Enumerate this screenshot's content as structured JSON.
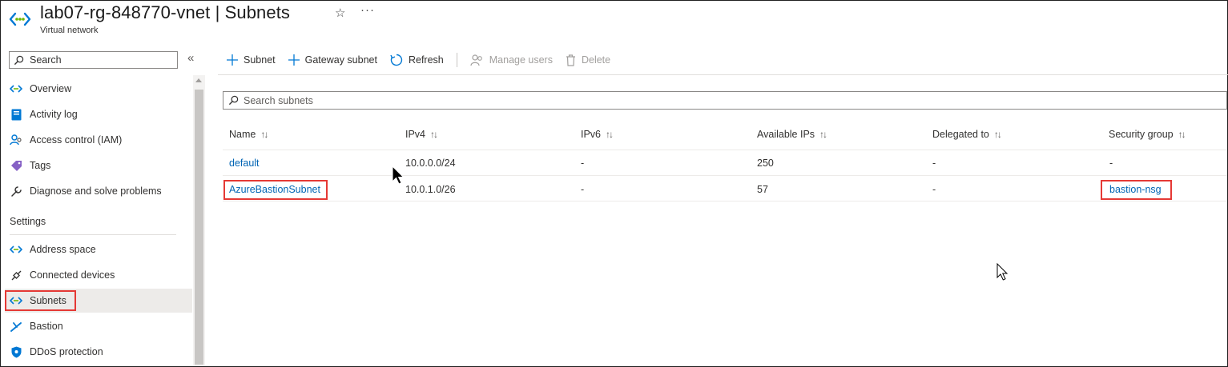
{
  "header": {
    "title": "lab07-rg-848770-vnet | Subnets",
    "subtitle": "Virtual network",
    "icon": "vnet-icon",
    "favorite_icon": "star-icon",
    "more_label": "···"
  },
  "sidebar": {
    "search_placeholder": "Search",
    "collapse_label": "«",
    "items_top": [
      {
        "label": "Overview",
        "icon": "overview-icon"
      },
      {
        "label": "Activity log",
        "icon": "activity-log-icon"
      },
      {
        "label": "Access control (IAM)",
        "icon": "iam-icon"
      },
      {
        "label": "Tags",
        "icon": "tag-icon"
      },
      {
        "label": "Diagnose and solve problems",
        "icon": "wrench-icon"
      }
    ],
    "section_settings": "Settings",
    "items_settings": [
      {
        "label": "Address space",
        "icon": "address-space-icon"
      },
      {
        "label": "Connected devices",
        "icon": "connected-devices-icon"
      },
      {
        "label": "Subnets",
        "icon": "subnets-icon",
        "active": true
      },
      {
        "label": "Bastion",
        "icon": "bastion-icon"
      },
      {
        "label": "DDoS protection",
        "icon": "shield-icon"
      }
    ]
  },
  "toolbar": {
    "add_subnet": "Subnet",
    "add_gateway_subnet": "Gateway subnet",
    "refresh": "Refresh",
    "manage_users": "Manage users",
    "delete": "Delete"
  },
  "subnet_search": {
    "placeholder": "Search subnets"
  },
  "table": {
    "columns": [
      "Name",
      "IPv4",
      "IPv6",
      "Available IPs",
      "Delegated to",
      "Security group"
    ],
    "sort_glyph": "↑↓",
    "rows": [
      {
        "name": "default",
        "ipv4": "10.0.0.0/24",
        "ipv6": "-",
        "available_ips": "250",
        "delegated_to": "-",
        "security_group": "-"
      },
      {
        "name": "AzureBastionSubnet",
        "ipv4": "10.0.1.0/26",
        "ipv6": "-",
        "available_ips": "57",
        "delegated_to": "-",
        "security_group": "bastion-nsg"
      }
    ]
  },
  "colors": {
    "link": "#0064b4",
    "highlight": "#e53935",
    "accent": "#0078d4"
  }
}
